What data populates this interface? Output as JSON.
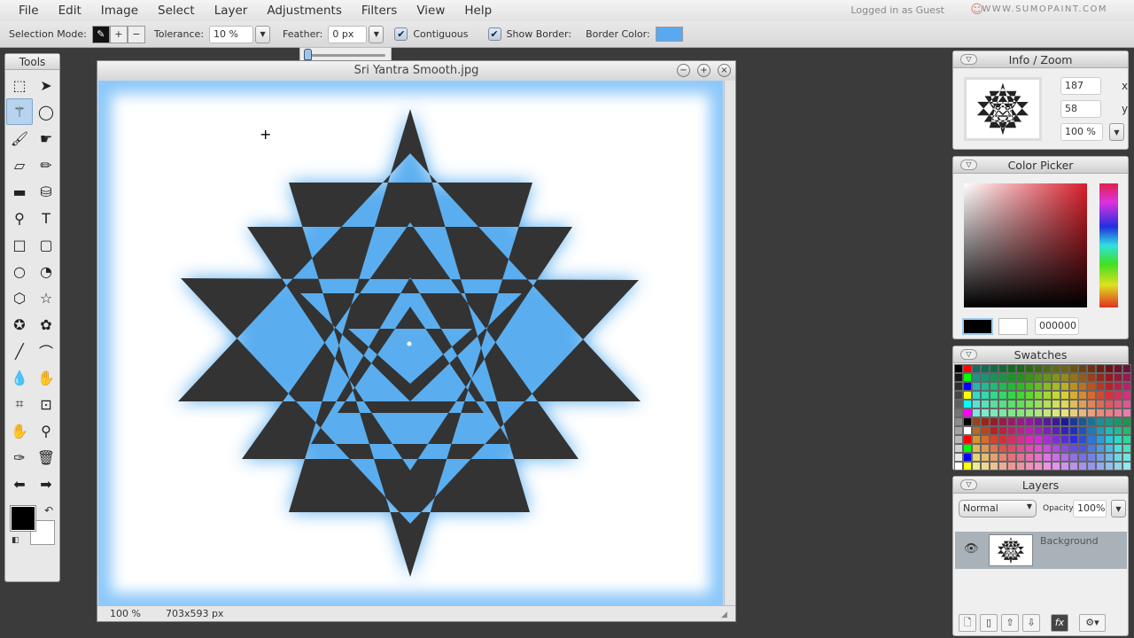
{
  "menu": [
    "File",
    "Edit",
    "Image",
    "Select",
    "Layer",
    "Adjustments",
    "Filters",
    "View",
    "Help"
  ],
  "login": "Logged in as Guest",
  "brand": "WWW.SUMOPAINT.COM",
  "options": {
    "selection_mode": "Selection Mode:",
    "tolerance_label": "Tolerance:",
    "tolerance": "10 %",
    "feather_label": "Feather:",
    "feather": "0 px",
    "contiguous": "Contiguous",
    "show_border": "Show Border:",
    "border_color_label": "Border Color:",
    "border_color": "#5aa9f0",
    "feather_slider": 0
  },
  "tools": {
    "title": "Tools",
    "items": [
      "rect-select",
      "move",
      "magic-wand",
      "lasso",
      "brush",
      "smudge",
      "eraser",
      "pencil",
      "gradient",
      "bucket",
      "clone-stamp",
      "text",
      "rectangle",
      "rounded-rect",
      "ellipse",
      "spiral",
      "polygon",
      "star",
      "star-burst",
      "flower",
      "line",
      "curve",
      "blur",
      "dodge",
      "crop",
      "transform",
      "hand",
      "zoom",
      "eyedropper",
      "trash",
      "undo",
      "redo"
    ]
  },
  "document": {
    "title": "Sri Yantra Smooth.jpg",
    "zoom": "100 %",
    "size": "703x593 px"
  },
  "info": {
    "title": "Info / Zoom",
    "x": "187",
    "x_label": "x",
    "y": "58",
    "y_label": "y",
    "zoom": "100 %"
  },
  "color_picker": {
    "title": "Color Picker",
    "hex": "000000",
    "fg": "#000000",
    "bg": "#ffffff"
  },
  "swatches": {
    "title": "Swatches"
  },
  "layers": {
    "title": "Layers",
    "blend": "Normal",
    "opacity_label": "Opacity:",
    "opacity": "100%",
    "items": [
      {
        "name": "Background",
        "visible": true
      }
    ]
  }
}
